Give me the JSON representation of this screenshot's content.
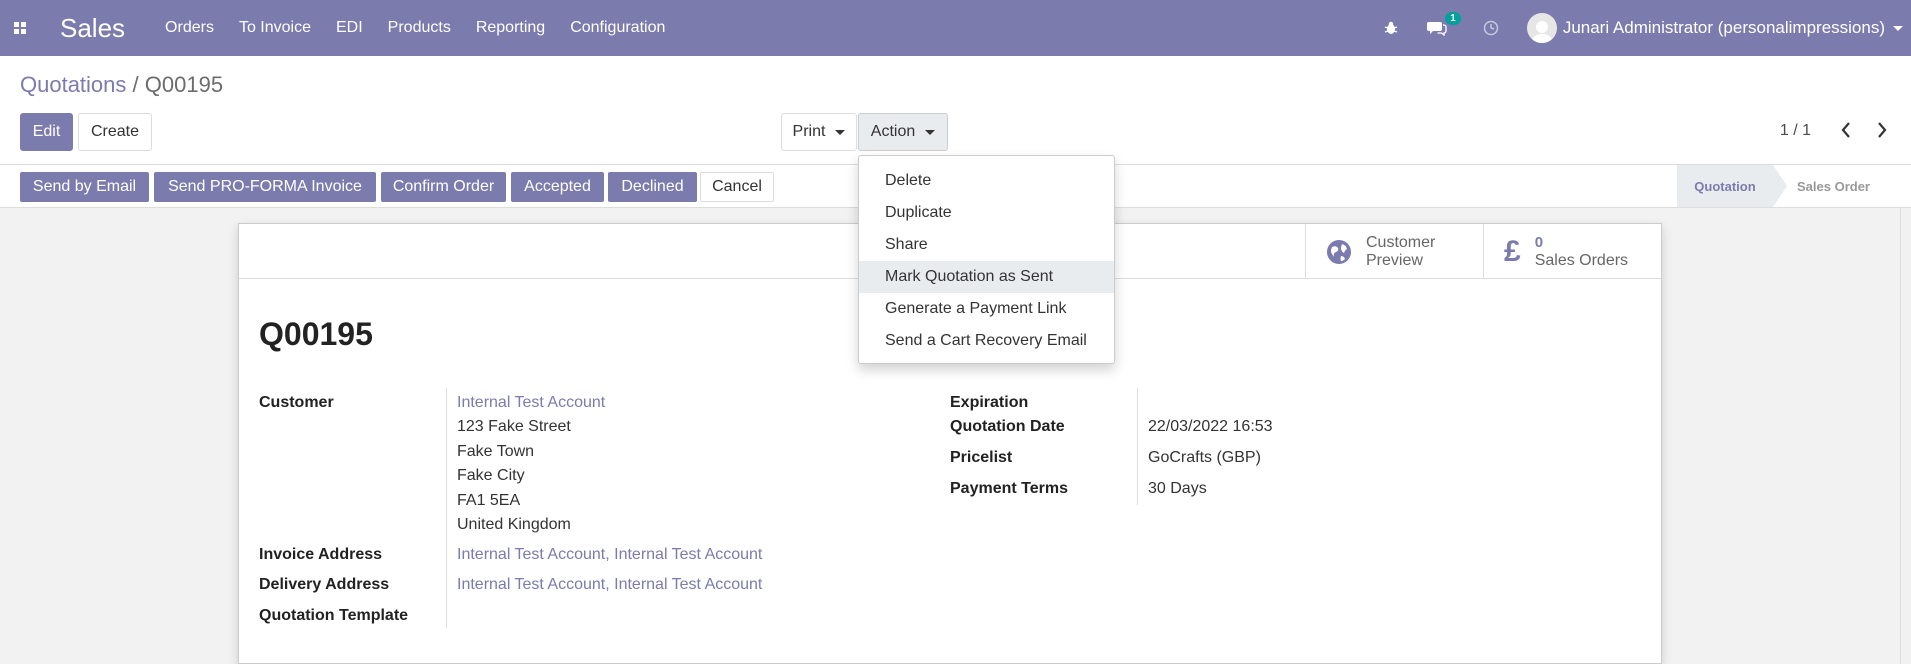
{
  "navbar": {
    "app_name": "Sales",
    "menu": [
      "Orders",
      "To Invoice",
      "EDI",
      "Products",
      "Reporting",
      "Configuration"
    ],
    "messages_badge": "1",
    "user_name": "Junari Administrator (personalimpressions)"
  },
  "breadcrumb": {
    "parent": "Quotations",
    "separator": "/",
    "current": "Q00195"
  },
  "buttons": {
    "edit": "Edit",
    "create": "Create",
    "print": "Print",
    "action": "Action"
  },
  "pager": {
    "value": "1 / 1"
  },
  "statusbar": {
    "buttons": [
      "Send by Email",
      "Send PRO-FORMA Invoice",
      "Confirm Order",
      "Accepted",
      "Declined",
      "Cancel"
    ],
    "stages": {
      "active": "Quotation",
      "next": "Sales Order"
    }
  },
  "action_menu": {
    "items": [
      "Delete",
      "Duplicate",
      "Share",
      "Mark Quotation as Sent",
      "Generate a Payment Link",
      "Send a Cart Recovery Email"
    ],
    "highlighted": "Mark Quotation as Sent"
  },
  "smart_buttons": {
    "customer_preview": [
      "Customer",
      "Preview"
    ],
    "sales_orders_count": "0",
    "sales_orders_label": "Sales Orders"
  },
  "record": {
    "name": "Q00195",
    "left": {
      "customer_label": "Customer",
      "customer_name": "Internal Test Account",
      "address": [
        "123 Fake Street",
        "Fake Town",
        "Fake City",
        "FA1 5EA",
        "United Kingdom"
      ],
      "invoice_label": "Invoice Address",
      "invoice_value": "Internal Test Account, Internal Test Account",
      "delivery_label": "Delivery Address",
      "delivery_value": "Internal Test Account, Internal Test Account",
      "template_label": "Quotation Template"
    },
    "right": {
      "expiration_label": "Expiration",
      "quotation_date_label": "Quotation Date",
      "quotation_date_value": "22/03/2022 16:53",
      "pricelist_label": "Pricelist",
      "pricelist_value": "GoCrafts (GBP)",
      "payment_terms_label": "Payment Terms",
      "payment_terms_value": "30 Days"
    }
  },
  "colors": {
    "brand": "#7c7bad",
    "badge": "#00a09d"
  }
}
